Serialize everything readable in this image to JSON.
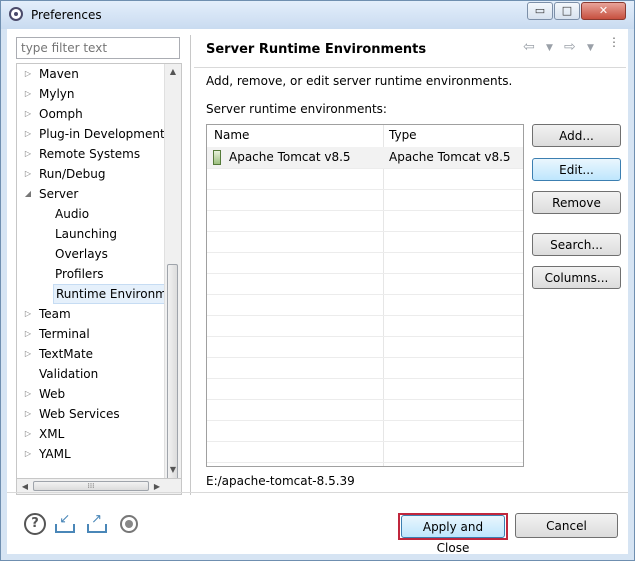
{
  "window": {
    "title": "Preferences",
    "minimize_glyph": "▭",
    "maximize_glyph": "□",
    "close_glyph": "✕"
  },
  "sidebar": {
    "filter_placeholder": "type filter text",
    "items": [
      {
        "label": "Maven",
        "expandable": true
      },
      {
        "label": "Mylyn",
        "expandable": true
      },
      {
        "label": "Oomph",
        "expandable": true
      },
      {
        "label": "Plug-in Development",
        "expandable": true
      },
      {
        "label": "Remote Systems",
        "expandable": true
      },
      {
        "label": "Run/Debug",
        "expandable": true
      },
      {
        "label": "Server",
        "expandable": true,
        "expanded": true
      },
      {
        "label": "Audio",
        "child": true
      },
      {
        "label": "Launching",
        "child": true
      },
      {
        "label": "Overlays",
        "child": true
      },
      {
        "label": "Profilers",
        "child": true
      },
      {
        "label": "Runtime Environme",
        "child": true,
        "selected": true
      },
      {
        "label": "Team",
        "expandable": true
      },
      {
        "label": "Terminal",
        "expandable": true
      },
      {
        "label": "TextMate",
        "expandable": true
      },
      {
        "label": "Validation",
        "expandable": false
      },
      {
        "label": "Web",
        "expandable": true
      },
      {
        "label": "Web Services",
        "expandable": true
      },
      {
        "label": "XML",
        "expandable": true
      },
      {
        "label": "YAML",
        "expandable": true
      }
    ]
  },
  "page": {
    "title": "Server Runtime Environments",
    "description": "Add, remove, or edit server runtime environments.",
    "table_label": "Server runtime environments:",
    "columns": [
      "Name",
      "Type"
    ],
    "rows": [
      {
        "name": "Apache Tomcat v8.5",
        "type": "Apache Tomcat v8.5"
      }
    ],
    "buttons": {
      "add": "Add...",
      "edit": "Edit...",
      "remove": "Remove",
      "search": "Search...",
      "columns": "Columns..."
    },
    "selected_location": "E:/apache-tomcat-8.5.39"
  },
  "footer": {
    "help_glyph": "?",
    "apply_close": "Apply and Close",
    "cancel": "Cancel"
  },
  "colors": {
    "focus_outline": "#c0263c",
    "selection": "#e5f0fb",
    "titlebar": "#d6e4f3"
  }
}
